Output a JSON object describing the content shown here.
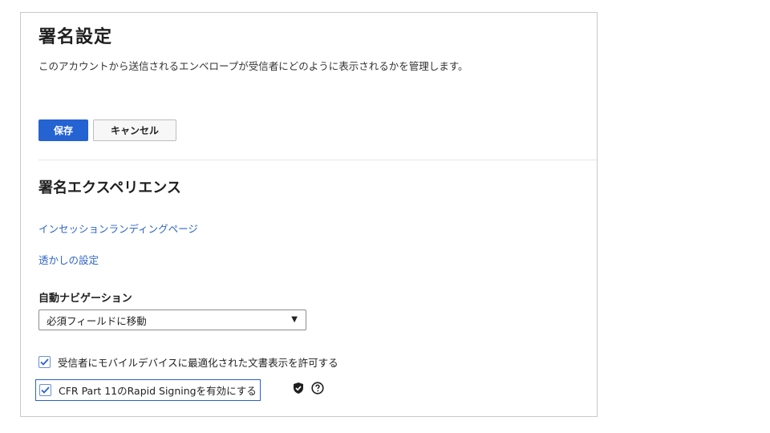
{
  "page": {
    "title": "署名設定",
    "description": "このアカウントから送信されるエンベロープが受信者にどのように表示されるかを管理します。"
  },
  "actions": {
    "save_label": "保存",
    "cancel_label": "キャンセル"
  },
  "section": {
    "title": "署名エクスペリエンス",
    "links": [
      {
        "label": "インセッションランディングページ"
      },
      {
        "label": "透かしの設定"
      }
    ],
    "auto_navigation": {
      "label": "自動ナビゲーション",
      "selected": "必須フィールドに移動"
    },
    "checkboxes": [
      {
        "label": "受信者にモバイルデバイスに最適化された文書表示を許可する",
        "checked": true
      },
      {
        "label": "CFR Part 11のRapid Signingを有効にする",
        "checked": true
      }
    ]
  },
  "icons": {
    "shield": "shield-check-icon",
    "help": "help-circle-icon"
  },
  "colors": {
    "primary": "#2463d1",
    "link": "#2f65c9",
    "focus": "#2a5fcf"
  }
}
